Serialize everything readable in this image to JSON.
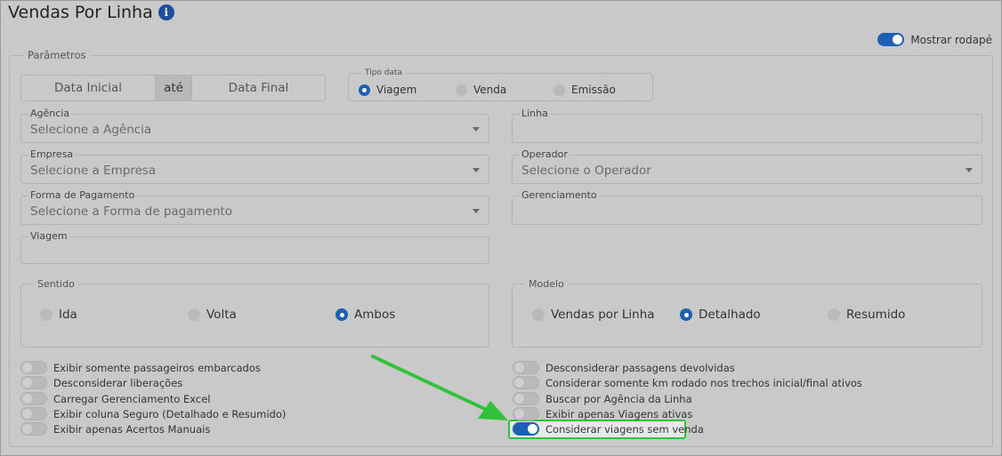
{
  "header": {
    "title": "Vendas Por Linha",
    "info_icon": "info-icon"
  },
  "footer_toggle": {
    "label": "Mostrar rodapé",
    "on": true
  },
  "params": {
    "legend": "Parâmetros",
    "date_start": "Data Inicial",
    "date_sep": "até",
    "date_end": "Data Final",
    "tipo_data": {
      "legend": "Tipo data",
      "options": [
        "Viagem",
        "Venda",
        "Emissão"
      ],
      "selected": "Viagem"
    },
    "fields": {
      "agencia": {
        "label": "Agência",
        "placeholder": "Selecione a Agência"
      },
      "linha": {
        "label": "Linha",
        "value": ""
      },
      "empresa": {
        "label": "Empresa",
        "placeholder": "Selecione a Empresa"
      },
      "operador": {
        "label": "Operador",
        "placeholder": "Selecione o Operador"
      },
      "forma_pagamento": {
        "label": "Forma de Pagamento",
        "placeholder": "Selecione a Forma de pagamento"
      },
      "gerenciamento": {
        "label": "Gerenciamento",
        "value": ""
      },
      "viagem": {
        "label": "Viagem",
        "value": ""
      }
    },
    "sentido": {
      "legend": "Sentido",
      "options": [
        "Ida",
        "Volta",
        "Ambos"
      ],
      "selected": "Ambos"
    },
    "modelo": {
      "legend": "Modelo",
      "options": [
        "Vendas por Linha",
        "Detalhado",
        "Resumido"
      ],
      "selected": "Detalhado"
    },
    "toggles_left": [
      "Exibir somente passageiros embarcados",
      "Desconsiderar liberações",
      "Carregar Gerenciamento Excel",
      "Exibir coluna Seguro (Detalhado e Resumido)",
      "Exibir apenas Acertos Manuais"
    ],
    "toggles_right": [
      "Desconsiderar passagens devolvidas",
      "Considerar somente km rodado nos trechos inicial/final ativos",
      "Buscar por Agência da Linha",
      "Exibir apenas Viagens ativas",
      "Considerar viagens sem venda"
    ],
    "toggles_right_on": [
      false,
      false,
      false,
      false,
      true
    ]
  },
  "colors": {
    "accent": "#1c5fb4",
    "highlight": "#2fc23a",
    "arrow": "#2fc23a"
  }
}
